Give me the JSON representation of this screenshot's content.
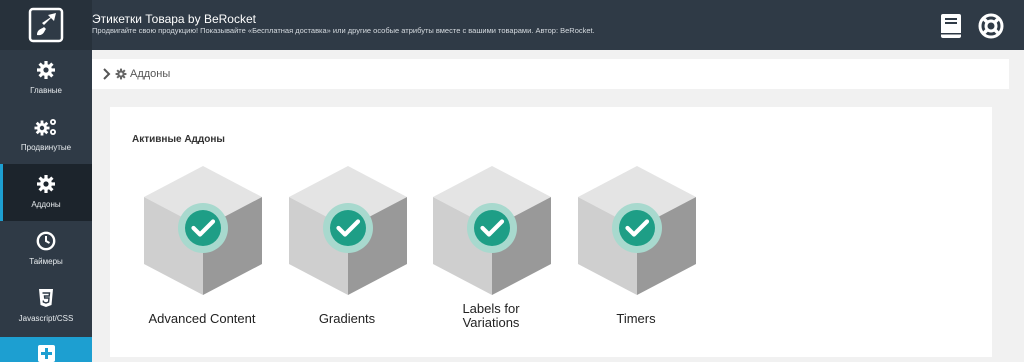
{
  "header": {
    "title": "Этикетки Товара by BeRocket",
    "subtitle": "Продвигайте свою продукцию! Показывайте «Бесплатная доставка» или другие особые атрибуты вместе с вашими товарами. Автор: BeRocket.",
    "icons": [
      "logo-icon",
      "book-icon",
      "lifebuoy-icon"
    ]
  },
  "sidebar": {
    "items": [
      {
        "label": "Главные",
        "icon": "gear-icon"
      },
      {
        "label": "Продвинутые",
        "icon": "gears-icon"
      },
      {
        "label": "Аддоны",
        "icon": "gear-icon",
        "active": true
      },
      {
        "label": "Таймеры",
        "icon": "clock-icon"
      },
      {
        "label": "Javascript/CSS",
        "icon": "css3-icon"
      }
    ],
    "add_icon": "plus-icon",
    "accent_color": "#1d9fd1"
  },
  "breadcrumb": {
    "label": "Аддоны"
  },
  "panel": {
    "title": "Активные Аддоны",
    "addons": [
      {
        "label": "Advanced Content"
      },
      {
        "label_line1": "Labels for",
        "label_line2": "Variations"
      },
      {
        "label": "Gradients"
      },
      {
        "label": "Timers"
      }
    ],
    "check_color": "#1e9e86"
  }
}
